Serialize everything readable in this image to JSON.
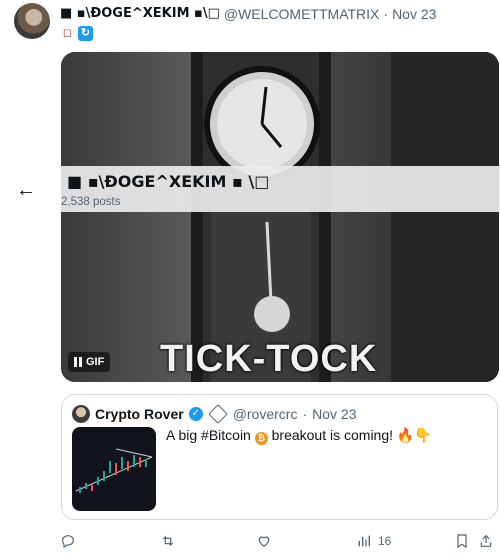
{
  "tweet": {
    "display_name": "■ ▪\\ĐOGE^XEKIM ▪\\□",
    "handle": "@WELCOMETTMATRIX",
    "separator": "·",
    "date": "Nov 23"
  },
  "sticky_header": {
    "name": "■  ▪\\ĐOGE^XEKIM ▪ \\□",
    "post_count": "2,538 posts"
  },
  "media": {
    "gif_label": "GIF",
    "caption": "TICK-TOCK"
  },
  "quoted_tweet": {
    "name": "Crypto Rover",
    "handle": "@rovercrc",
    "separator": "·",
    "date": "Nov 23",
    "text_before": "A big #Bitcoin",
    "text_after": " breakout is coming! 🔥👇",
    "btc_symbol": "₿"
  },
  "actions": {
    "views_count": "16"
  },
  "icons": {
    "back": "back-arrow-icon",
    "reply": "reply-icon",
    "repost": "repost-icon",
    "like": "like-icon",
    "views": "views-icon",
    "bookmark": "bookmark-icon",
    "share": "share-icon"
  },
  "colors": {
    "accent": "#1d9bf0",
    "muted": "#536471",
    "border": "#cfd9de"
  }
}
